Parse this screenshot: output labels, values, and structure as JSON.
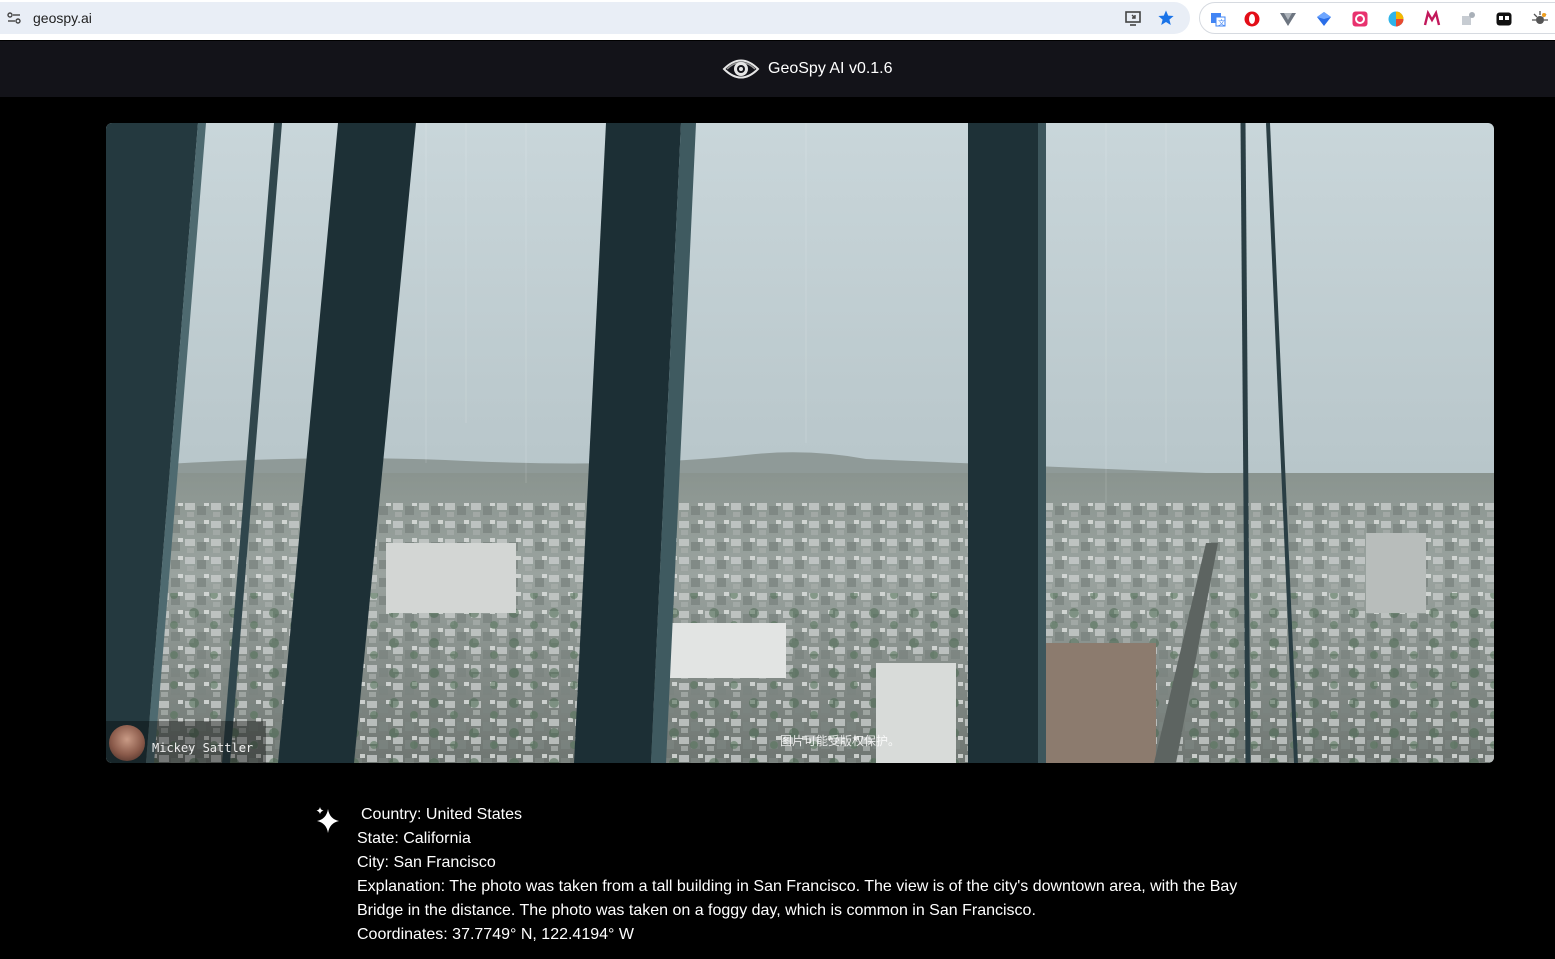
{
  "browser": {
    "url": "geospy.ai",
    "icons": [
      "site-info-icon",
      "install-app-icon",
      "bookmark-star-icon"
    ],
    "extensions": [
      "translate-icon",
      "opera-icon",
      "vue-devtools-icon",
      "ext-blue-icon",
      "ext-pink-icon",
      "ext-colorful-icon",
      "ext-m-icon",
      "ext-puzzle-gray-icon",
      "ext-dark-icon",
      "ext-bug-icon"
    ]
  },
  "app": {
    "title": "GeoSpy AI v0.1.6"
  },
  "photo": {
    "credit_name": "Mickey Sattler",
    "watermark": "图片可能受版权保护。"
  },
  "result": {
    "country": "Country: United States",
    "state": "State: California",
    "city": "City: San Francisco",
    "explanation": "Explanation: The photo was taken from a tall building in San Francisco. The view is of the city's downtown area, with the Bay Bridge in the distance. The photo was taken on a foggy day, which is common in San Francisco.",
    "coordinates": "Coordinates: 37.7749° N, 122.4194° W"
  },
  "colors": {
    "header_bg": "#131319",
    "page_bg": "#000000",
    "omnibox_bg": "#e9eef6",
    "bookmark_blue": "#1a73e8"
  }
}
